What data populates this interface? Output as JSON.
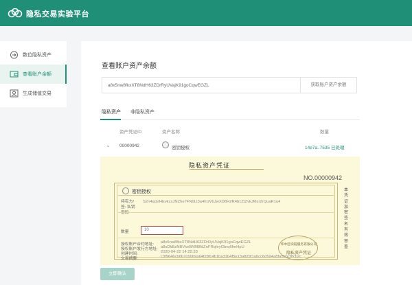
{
  "app": {
    "title": "隐私交易实验平台",
    "accent": "#1f8f78"
  },
  "sidebar": {
    "items": [
      {
        "label": "数位隐私资产",
        "icon": "create-icon",
        "active": false
      },
      {
        "label": "查看账户余额",
        "icon": "wallet-icon",
        "active": true
      },
      {
        "label": "生成储值交易",
        "icon": "account-icon",
        "active": false
      }
    ]
  },
  "main": {
    "title": "查看账户资产余额",
    "address_value": "a8x5nw8fkxXT8NdH63ZDrRyUVajK91goCqwEGZL",
    "address_button": "获取账户资产余额",
    "tabs": [
      "隐私资产",
      "非隐私资产"
    ],
    "table": {
      "headers": [
        "资产凭证ID",
        "资产名称",
        "数量"
      ],
      "rows": [
        {
          "id": "00000942",
          "name": "密钥授权",
          "amount": "14e7a..7535 已处理"
        }
      ]
    },
    "certificate": {
      "title": "隐私资产凭证",
      "number": "NO.00000942",
      "asset_name": "密钥授权",
      "side_text": "本凭证加密签名有效审查",
      "fields": [
        {
          "label": "持有方/签: 私钥密码",
          "value": "S2n4qqVHEvkcxJNZhe7FN0Lt3a4hUVbJwXD8H2R4b1ZtZvkJMzr2rQuaR1u4"
        },
        {
          "label": "数量",
          "value": "10"
        },
        {
          "label": "授权账户合约地址:",
          "value": "a8x5nw8fkxXT8NdH63ZDrRyUVajK91goCqwEGZL"
        },
        {
          "label": "授权账户发行方地址:",
          "value": "a8xDkBzNBVkeBNM8fdZnFRqfeyGbrq6fmHpU"
        },
        {
          "label": "创建时间:",
          "value": "2020-04-22 14:22:33"
        },
        {
          "label": "交易摘要:",
          "value": "c3f964bcb6b7cbb69ab4f28fc4b1ba31b4f5e13a829f1a0cc6d5d4a8fa5bbc8fcb2c"
        }
      ],
      "stamp_line1": "华中区块链服务有限公司",
      "stamp_line2": "隐私资产凭证"
    },
    "confirm_button": "立即确认"
  }
}
